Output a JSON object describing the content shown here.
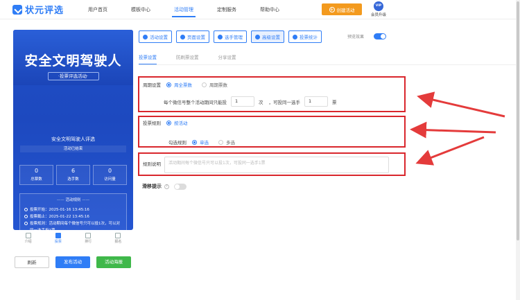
{
  "brand": {
    "name": "状元评选"
  },
  "nav": {
    "items": [
      {
        "label": "用户首页"
      },
      {
        "label": "模板中心"
      },
      {
        "label": "活动管理"
      },
      {
        "label": "定制服务"
      },
      {
        "label": "帮助中心"
      }
    ],
    "create_label": "创建活动",
    "vip_badge": "VIP",
    "vip_label": "会员升级"
  },
  "preview": {
    "banner_title": "安全文明驾驶人",
    "banner_sub": "·投票评选活动·",
    "activity_name": "安全文明驾驶人评选",
    "status": "活动已结束",
    "stats": [
      {
        "value": "0",
        "label": "总票数"
      },
      {
        "value": "6",
        "label": "选手数"
      },
      {
        "value": "0",
        "label": "访问量"
      }
    ],
    "rules_title": "活动规则",
    "rules": [
      "投票开始：2025-01-16 13:45:16",
      "投票截止：2025-01-22 13:45:16",
      "投票规则：活动期间每个微信号只可以投1次，可以对同一选手投1票"
    ],
    "tabs": [
      {
        "label": "介绍"
      },
      {
        "label": "投票"
      },
      {
        "label": "排行"
      },
      {
        "label": "报名"
      }
    ]
  },
  "actions": {
    "refresh": "刷新",
    "publish": "发布活动",
    "poster": "活动海报"
  },
  "toolbar": {
    "buttons": [
      {
        "label": "活动设置"
      },
      {
        "label": "页面设置"
      },
      {
        "label": "选手管理"
      },
      {
        "label": "高级设置"
      },
      {
        "label": "投票统计"
      }
    ],
    "preview_label": "预览效果"
  },
  "subtabs": [
    {
      "label": "投票设置"
    },
    {
      "label": "防刷票设置"
    },
    {
      "label": "分享设置"
    }
  ],
  "settings": {
    "period_label": "周期设置",
    "period_opt1": "周全票数",
    "period_opt2": "周期票数",
    "limit_prefix": "每个微信号整个活动期间只能投",
    "limit_value": "1",
    "limit_unit": "次",
    "same_prefix": "，可投同一选手",
    "same_value": "1",
    "same_unit": "票",
    "rule_label": "投票规则",
    "rule_opt": "按活动",
    "check_label": "勾选规则",
    "check_opt1": "单选",
    "check_opt2": "多选",
    "desc_label": "规则说明",
    "desc_placeholder": "活动期间每个微信号只可以投1次，可投同一选手1票",
    "verify_label": "滑移提示"
  },
  "colors": {
    "primary": "#2f7df6",
    "accent_orange": "#f39a1e",
    "accent_green": "#3fb84a",
    "highlight_red": "#d9262c"
  }
}
